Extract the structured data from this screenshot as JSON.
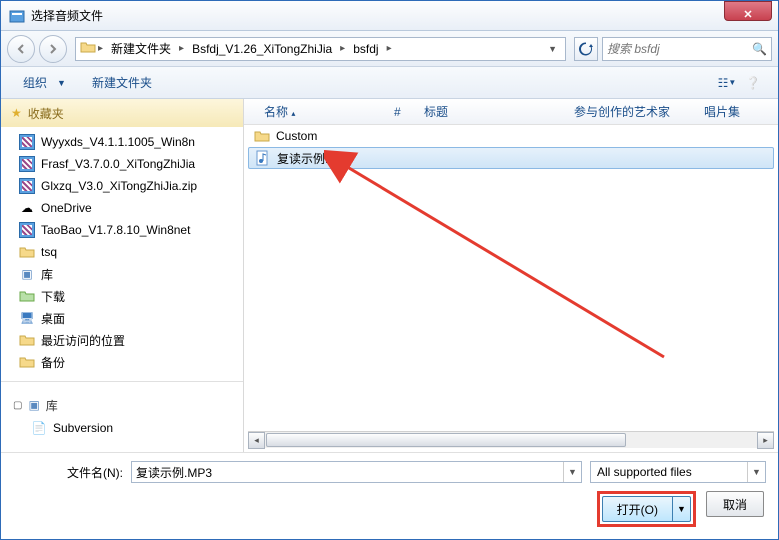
{
  "window": {
    "title": "选择音频文件"
  },
  "nav": {
    "breadcrumb": [
      "新建文件夹",
      "Bsfdj_V1.26_XiTongZhiJia",
      "bsfdj"
    ],
    "search_placeholder": "搜索 bsfdj"
  },
  "toolbar": {
    "organize": "组织",
    "newfolder": "新建文件夹"
  },
  "sidebar": {
    "favorites_label": "收藏夹",
    "favorites": [
      "Wyyxds_V4.1.1.1005_Win8n",
      "Frasf_V3.7.0.0_XiTongZhiJia",
      "Glxzq_V3.0_XiTongZhiJia.zip",
      "OneDrive",
      "TaoBao_V1.7.8.10_Win8net",
      "tsq",
      "库",
      "下载",
      "桌面",
      "最近访问的位置",
      "备份"
    ],
    "libraries_label": "库",
    "libraries": [
      "Subversion"
    ]
  },
  "columns": {
    "name": "名称",
    "num": "#",
    "title": "标题",
    "artist": "参与创作的艺术家",
    "album": "唱片集"
  },
  "files": {
    "folder": "Custom",
    "selected": "复读示例.MP3"
  },
  "footer": {
    "filename_label": "文件名(N):",
    "filename_value": "复读示例.MP3",
    "filter": "All supported files",
    "open": "打开(O)",
    "cancel": "取消"
  }
}
